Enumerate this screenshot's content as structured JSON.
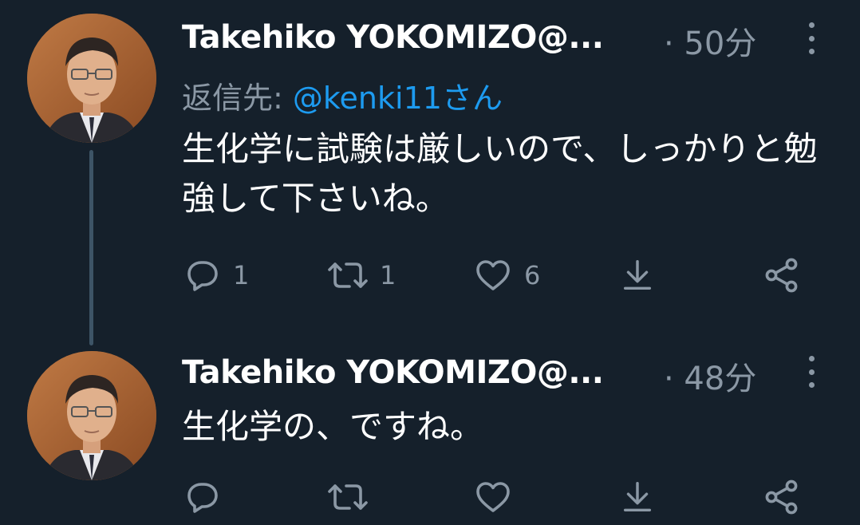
{
  "colors": {
    "background": "#15202b",
    "text": "#ffffff",
    "muted": "#8b98a5",
    "link": "#1d9bf0",
    "thread_line": "#3d5466"
  },
  "tweets": [
    {
      "author": "Takehiko YOKOMIZO@...",
      "time": "· 50分",
      "reply_prefix": "返信先:",
      "reply_handle": "@kenki11さん",
      "text": "生化学に試験は厳しいので、しっかりと勉強して下さいね。",
      "replies": "1",
      "retweets": "1",
      "likes": "6"
    },
    {
      "author": "Takehiko YOKOMIZO@...",
      "time": "· 48分",
      "text": "生化学の、ですね。",
      "replies": "",
      "retweets": "",
      "likes": ""
    }
  ],
  "icons": {
    "reply": "reply-icon",
    "retweet": "retweet-icon",
    "like": "heart-icon",
    "download": "download-icon",
    "share": "share-icon",
    "more": "more-options-icon"
  }
}
